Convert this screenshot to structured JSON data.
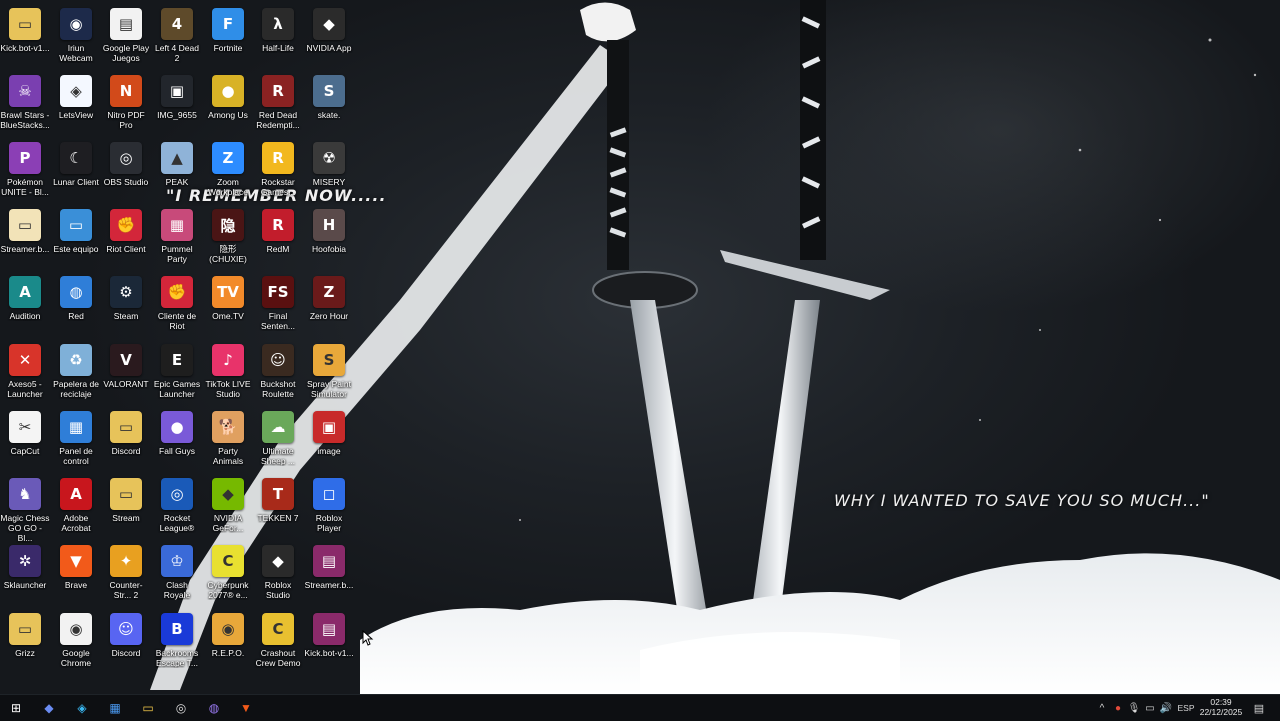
{
  "wallpaper": {
    "quote_top": "\"I REMEMBER NOW.....",
    "quote_bottom": "WHY I WANTED TO SAVE YOU SO MUCH...\""
  },
  "desktop_icons": [
    {
      "label": "Kick.bot-v1...",
      "icon": "folder-icon",
      "color": "#e7c35a",
      "glyph": "▭"
    },
    {
      "label": "Iriun Webcam",
      "icon": "webcam-icon",
      "color": "#1d2a4a",
      "glyph": "◉"
    },
    {
      "label": "Google Play Juegos",
      "icon": "file-icon",
      "color": "#f2f2f2",
      "glyph": "▤"
    },
    {
      "label": "Left 4 Dead 2",
      "icon": "l4d2-icon",
      "color": "#5e4a2a",
      "glyph": "4"
    },
    {
      "label": "Fortnite",
      "icon": "fortnite-icon",
      "color": "#2f8ee8",
      "glyph": "F"
    },
    {
      "label": "Half-Life",
      "icon": "halflife-icon",
      "color": "#2a2a2a",
      "glyph": "λ"
    },
    {
      "label": "NVIDIA App",
      "icon": "nvidia-icon",
      "color": "#2b2b2b",
      "glyph": "◆"
    },
    {
      "label": "Brawl Stars - BlueStacks...",
      "icon": "brawlstars-icon",
      "color": "#7a3fb0",
      "glyph": "☠"
    },
    {
      "label": "LetsView",
      "icon": "letsview-icon",
      "color": "#f4f8ff",
      "glyph": "◈"
    },
    {
      "label": "Nitro PDF Pro",
      "icon": "nitro-icon",
      "color": "#d24a1a",
      "glyph": "N"
    },
    {
      "label": "IMG_9655",
      "icon": "image-icon",
      "color": "#22262c",
      "glyph": "▣"
    },
    {
      "label": "Among Us",
      "icon": "amongus-icon",
      "color": "#d8b226",
      "glyph": "●"
    },
    {
      "label": "Red Dead Redempti...",
      "icon": "rdr-icon",
      "color": "#8a2222",
      "glyph": "R"
    },
    {
      "label": "skate.",
      "icon": "skate-icon",
      "color": "#4c6d8e",
      "glyph": "S"
    },
    {
      "label": "Pokémon UNITE - Bl...",
      "icon": "pokemon-icon",
      "color": "#8b3fb5",
      "glyph": "P"
    },
    {
      "label": "Lunar Client",
      "icon": "lunar-icon",
      "color": "#1e1e22",
      "glyph": "☾"
    },
    {
      "label": "OBS Studio",
      "icon": "obs-icon",
      "color": "#2a2d33",
      "glyph": "◎"
    },
    {
      "label": "PEAK",
      "icon": "peak-icon",
      "color": "#8fb3d8",
      "glyph": "▲"
    },
    {
      "label": "Zoom Workplace",
      "icon": "zoom-icon",
      "color": "#2d8cff",
      "glyph": "Z"
    },
    {
      "label": "Rockstar Games...",
      "icon": "rockstar-icon",
      "color": "#f2b81e",
      "glyph": "R"
    },
    {
      "label": "MISERY",
      "icon": "misery-icon",
      "color": "#3a3a3a",
      "glyph": "☢"
    },
    {
      "label": "Streamer.b...",
      "icon": "folder-icon",
      "color": "#f2e3b8",
      "glyph": "▭"
    },
    {
      "label": "Este equipo",
      "icon": "computer-icon",
      "color": "#3a8fd8",
      "glyph": "▭"
    },
    {
      "label": "Riot Client",
      "icon": "riot-icon",
      "color": "#d3263a",
      "glyph": "✊"
    },
    {
      "label": "Pummel Party",
      "icon": "pummel-icon",
      "color": "#c84a7a",
      "glyph": "▦"
    },
    {
      "label": "隐形 (CHUXIE)",
      "icon": "chuxie-icon",
      "color": "#4a1515",
      "glyph": "隐"
    },
    {
      "label": "RedM",
      "icon": "redm-icon",
      "color": "#c21d2c",
      "glyph": "R"
    },
    {
      "label": "Hoofobia",
      "icon": "hoofobia-icon",
      "color": "#5a4a4a",
      "glyph": "H"
    },
    {
      "label": "Audition",
      "icon": "audition-icon",
      "color": "#1a8a8a",
      "glyph": "A"
    },
    {
      "label": "Red",
      "icon": "network-icon",
      "color": "#2f7ed8",
      "glyph": "◍"
    },
    {
      "label": "Steam",
      "icon": "steam-icon",
      "color": "#1b2838",
      "glyph": "⚙"
    },
    {
      "label": "Cliente de Riot",
      "icon": "riot-client-icon",
      "color": "#d3263a",
      "glyph": "✊"
    },
    {
      "label": "Ome.TV",
      "icon": "ometv-icon",
      "color": "#f28a2a",
      "glyph": "TV"
    },
    {
      "label": "Final Senten...",
      "icon": "final-sentence-icon",
      "color": "#5a1010",
      "glyph": "FS"
    },
    {
      "label": "Zero Hour",
      "icon": "zerohour-icon",
      "color": "#6a1a1a",
      "glyph": "Z"
    },
    {
      "label": "Axeso5 - Launcher",
      "icon": "axeso5-icon",
      "color": "#d8342a",
      "glyph": "✕"
    },
    {
      "label": "Papelera de reciclaje",
      "icon": "recycle-bin-icon",
      "color": "#7fb0d8",
      "glyph": "♻"
    },
    {
      "label": "VALORANT",
      "icon": "valorant-icon",
      "color": "#2a1a1e",
      "glyph": "V"
    },
    {
      "label": "Epic Games Launcher",
      "icon": "epic-icon",
      "color": "#1e1e1e",
      "glyph": "E"
    },
    {
      "label": "TikTok LIVE Studio",
      "icon": "tiktok-icon",
      "color": "#e8336a",
      "glyph": "♪"
    },
    {
      "label": "Buckshot Roulette",
      "icon": "buckshot-icon",
      "color": "#3a2a20",
      "glyph": "☺"
    },
    {
      "label": "Spray Paint Simulator",
      "icon": "spraypaint-icon",
      "color": "#e8a83a",
      "glyph": "S"
    },
    {
      "label": "CapCut",
      "icon": "capcut-icon",
      "color": "#f4f4f4",
      "glyph": "✂"
    },
    {
      "label": "Panel de control",
      "icon": "control-panel-icon",
      "color": "#2f7ed8",
      "glyph": "▦"
    },
    {
      "label": "Discord",
      "icon": "folder-icon",
      "color": "#e7c35a",
      "glyph": "▭"
    },
    {
      "label": "Fall Guys",
      "icon": "fallguys-icon",
      "color": "#7a5ad8",
      "glyph": "●"
    },
    {
      "label": "Party Animals",
      "icon": "party-animals-icon",
      "color": "#e0a060",
      "glyph": "🐕"
    },
    {
      "label": "Ultimate Sheep ...",
      "icon": "sheep-icon",
      "color": "#6aa85a",
      "glyph": "☁"
    },
    {
      "label": "image",
      "icon": "image-icon",
      "color": "#c82a2a",
      "glyph": "▣"
    },
    {
      "label": "Magic Chess GO GO - Bl...",
      "icon": "magicchess-icon",
      "color": "#6a5ab8",
      "glyph": "♞"
    },
    {
      "label": "Adobe Acrobat",
      "icon": "acrobat-icon",
      "color": "#c8161d",
      "glyph": "A"
    },
    {
      "label": "Stream",
      "icon": "folder-icon",
      "color": "#e7c35a",
      "glyph": "▭"
    },
    {
      "label": "Rocket League®",
      "icon": "rocketleague-icon",
      "color": "#1a5ab8",
      "glyph": "◎"
    },
    {
      "label": "NVIDIA GeFor...",
      "icon": "geforce-icon",
      "color": "#76b900",
      "glyph": "◆"
    },
    {
      "label": "TEKKEN 7",
      "icon": "tekken-icon",
      "color": "#a82a1a",
      "glyph": "T"
    },
    {
      "label": "Roblox Player",
      "icon": "roblox-icon",
      "color": "#2f6de8",
      "glyph": "◻"
    },
    {
      "label": "Sklauncher",
      "icon": "sklauncher-icon",
      "color": "#3a2a6a",
      "glyph": "✲"
    },
    {
      "label": "Brave",
      "icon": "brave-icon",
      "color": "#f25a1a",
      "glyph": "▼"
    },
    {
      "label": "Counter-Str... 2",
      "icon": "cs2-icon",
      "color": "#e8a020",
      "glyph": "✦"
    },
    {
      "label": "Clash Royale",
      "icon": "clashroyale-icon",
      "color": "#3a6ad8",
      "glyph": "♔"
    },
    {
      "label": "Cyberpunk 2077® e...",
      "icon": "cyberpunk-icon",
      "color": "#e8e030",
      "glyph": "C"
    },
    {
      "label": "Roblox Studio",
      "icon": "roblox-studio-icon",
      "color": "#2a2a2a",
      "glyph": "◆"
    },
    {
      "label": "Streamer.b...",
      "icon": "winrar-icon",
      "color": "#8a2a6a",
      "glyph": "▤"
    },
    {
      "label": "Grizz",
      "icon": "folder-icon",
      "color": "#e7c35a",
      "glyph": "▭"
    },
    {
      "label": "Google Chrome",
      "icon": "chrome-icon",
      "color": "#f2f2f2",
      "glyph": "◉"
    },
    {
      "label": "Discord",
      "icon": "discord-icon",
      "color": "#5865f2",
      "glyph": "☺"
    },
    {
      "label": "Backrooms Escape T...",
      "icon": "backrooms-icon",
      "color": "#1a3ad8",
      "glyph": "B"
    },
    {
      "label": "R.E.P.O.",
      "icon": "repo-icon",
      "color": "#e8a83a",
      "glyph": "◉"
    },
    {
      "label": "Crashout Crew Demo",
      "icon": "crashout-icon",
      "color": "#e8c030",
      "glyph": "C"
    },
    {
      "label": "Kick.bot-v1...",
      "icon": "winrar-icon",
      "color": "#8a2a6a",
      "glyph": "▤"
    }
  ],
  "taskbar": {
    "items": [
      {
        "name": "start-button",
        "icon": "windows-icon",
        "glyph": "⊞",
        "color": "#ffffff"
      },
      {
        "name": "taskbar-app-1",
        "icon": "diamond-app-icon",
        "glyph": "◆",
        "color": "#6a8cf2"
      },
      {
        "name": "taskbar-app-2",
        "icon": "copilot-icon",
        "glyph": "◈",
        "color": "#3ab8f2"
      },
      {
        "name": "taskbar-store",
        "icon": "store-icon",
        "glyph": "▦",
        "color": "#4a9af2"
      },
      {
        "name": "taskbar-explorer",
        "icon": "folder-icon",
        "glyph": "▭",
        "color": "#f2c84a"
      },
      {
        "name": "taskbar-obs",
        "icon": "obs-icon",
        "glyph": "◎",
        "color": "#dddddd"
      },
      {
        "name": "taskbar-app-3",
        "icon": "app-icon",
        "glyph": "◍",
        "color": "#9a7af2"
      },
      {
        "name": "taskbar-brave",
        "icon": "brave-icon",
        "glyph": "▼",
        "color": "#f25a1a"
      }
    ],
    "tray": {
      "chevron": "^",
      "language": "ESP",
      "time": "02:39",
      "date": "22/12/2025"
    }
  }
}
